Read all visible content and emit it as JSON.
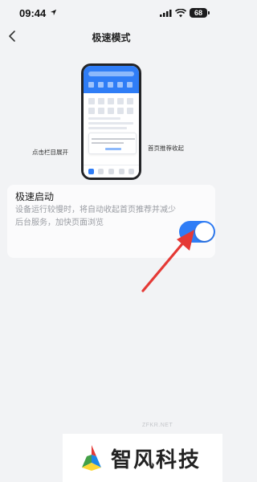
{
  "status_bar": {
    "time": "09:44",
    "battery": "68",
    "icons": [
      "location-arrow-icon",
      "signal-bars-icon",
      "wifi-icon",
      "battery-icon"
    ]
  },
  "nav": {
    "title": "极速模式",
    "back_icon": "chevron-left-icon"
  },
  "illustration": {
    "label_left": "点击栏目展开",
    "label_right": "首页推荐收起"
  },
  "setting": {
    "title": "极速启动",
    "description": "设备运行较慢时，将自动收起首页推荐并减少后台服务，加快页面浏览",
    "toggle_on": true
  },
  "colors": {
    "accent": "#2f7df6",
    "annotation": "#e53935",
    "background": "#f2f3f5"
  },
  "watermark": {
    "small": "ZFKR.NET",
    "brand": "智风科技"
  }
}
